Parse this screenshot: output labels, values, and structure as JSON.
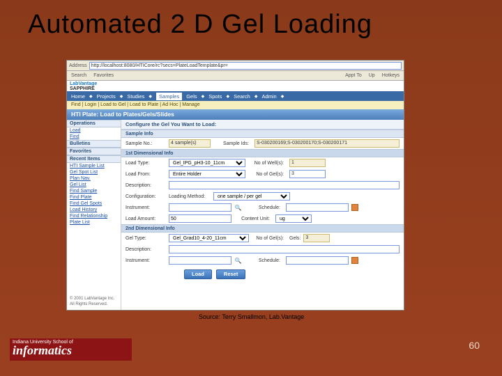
{
  "slide": {
    "title": "Automated 2 D Gel Loading",
    "source": "Source:  Terry Smallmon, Lab.Vantage",
    "pagenum": "60",
    "iu_small": "Indiana University School of",
    "iu_big": "informatics"
  },
  "browser": {
    "address_label": "Address",
    "url": "http://localhost:8080/HTICore/rc?secs=PlateLoadTemplate&pr=",
    "toolbar": [
      "Search",
      "Favorites",
      "Appt To",
      "Up",
      "Hotkeys"
    ]
  },
  "app": {
    "logo1": "LabVantage",
    "logo2": "SAPPHIRE",
    "nav": [
      "Home",
      "Projects",
      "Studies",
      "Samples",
      "Gels",
      "Spots",
      "Search",
      "Admin"
    ],
    "nav_active_index": 3,
    "subnav": "Find | Login | Load to Gel | Load to Plate | Ad Hoc | Manage",
    "title": "HTI Plate: Load to Plates/Gels/Slides",
    "sidebar": {
      "operations": {
        "label": "Operations",
        "items": [
          "Load",
          "Find"
        ]
      },
      "bulletins": {
        "label": "Bulletins"
      },
      "favorites": {
        "label": "Favorites"
      },
      "recent": {
        "label": "Recent Items",
        "items": [
          "HTI Sample List",
          "Gel Spot List",
          "Plan Nav.",
          "Gel List",
          "Find Sample",
          "Find Plate",
          "Find Gel Spots",
          "Load History",
          "Find Relationship",
          "Plate List"
        ]
      },
      "copyright": "© 2001 LabVantage Inc. All Rights Reserved."
    },
    "main": {
      "configure": "Configure the Gel You Want to Load:",
      "sample_info": {
        "label": "Sample Info",
        "sample_no_label": "Sample No.:",
        "sample_no": "4 sample(s)",
        "sample_ids_label": "Sample Ids:",
        "sample_ids": "S-030200169;S-030200170;S-030200171"
      },
      "dim1": {
        "label": "1st Dimensional Info",
        "load_type_label": "Load Type:",
        "load_type": "Gel_IPG_pH3-10_11cm",
        "no_wells_label": "No of Well(s):",
        "no_wells": "1",
        "load_from_label": "Load From:",
        "load_from": "Entire Holder",
        "no_gels_label": "No of Gel(s):",
        "no_gels": "3",
        "description_label": "Description:",
        "configuration_label": "Configuration:",
        "loading_method_label": "Loading Method:",
        "loading_method": "one sample / per gel",
        "instrument_label": "Instrument:",
        "schedule_label": "Schedule:",
        "load_amount_label": "Load Amount:",
        "load_amount": "50",
        "content_unit_label": "Content Unit:",
        "content_unit": "ug"
      },
      "dim2": {
        "label": "2nd Dimensional Info",
        "gel_type_label": "Gel Type:",
        "gel_type": "Gel_Grad10_4-20_11cm",
        "no_gels_label": "No of Gel(s):",
        "gels_label": "Gels:",
        "gels": "3",
        "description_label": "Description:",
        "instrument_label": "Instrument:",
        "schedule_label": "Schedule:"
      },
      "buttons": {
        "load": "Load",
        "reset": "Reset"
      }
    }
  }
}
